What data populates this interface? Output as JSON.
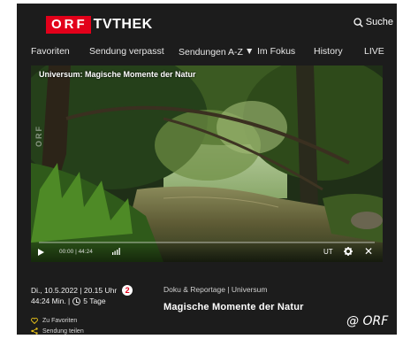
{
  "header": {
    "logo_orf": "ORF",
    "logo_tvthek": "TVTHEK",
    "search_label": "Suche"
  },
  "nav": {
    "items": [
      "Favoriten",
      "Sendung verpasst",
      "Sendungen A-Z",
      "Im Fokus",
      "History",
      "LIVE"
    ]
  },
  "player": {
    "title": "Universum: Magische Momente der Natur",
    "watermark": "ORF",
    "time": "00:00 | 44:24",
    "progress": 0,
    "subtitles_label": "UT",
    "volume_icon": "volume-bars-icon",
    "settings_icon": "gear-icon",
    "close_icon": "close-icon"
  },
  "info": {
    "date_time": "Di., 10.5.2022 | 20.15 Uhr",
    "channel_badge": "2",
    "duration": "44:24 Min. |",
    "availability": "5 Tage",
    "favorite_label": "Zu Favoriten",
    "share_label": "Sendung teilen",
    "genre": "Doku & Reportage | Universum",
    "show_title": "Magische Momente der Natur"
  },
  "copyright": "@ ORF",
  "colors": {
    "brand_red": "#e2001a",
    "background": "#1c1c1c",
    "accent_yellow": "#e8c21a"
  }
}
